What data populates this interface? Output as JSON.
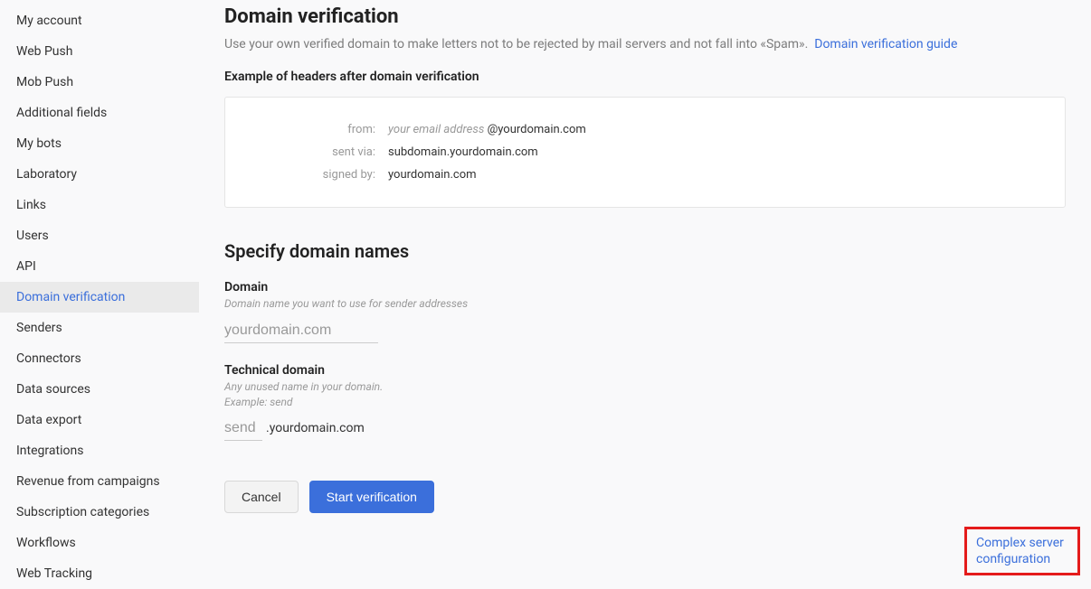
{
  "sidebar": {
    "items": [
      {
        "label": "My account"
      },
      {
        "label": "Web Push"
      },
      {
        "label": "Mob Push"
      },
      {
        "label": "Additional fields"
      },
      {
        "label": "My bots"
      },
      {
        "label": "Laboratory"
      },
      {
        "label": "Links"
      },
      {
        "label": "Users"
      },
      {
        "label": "API"
      },
      {
        "label": "Domain verification",
        "active": true
      },
      {
        "label": "Senders"
      },
      {
        "label": "Connectors"
      },
      {
        "label": "Data sources"
      },
      {
        "label": "Data export"
      },
      {
        "label": "Integrations"
      },
      {
        "label": "Revenue from campaigns"
      },
      {
        "label": "Subscription categories"
      },
      {
        "label": "Workflows"
      },
      {
        "label": "Web Tracking"
      }
    ]
  },
  "page": {
    "title": "Domain verification",
    "description": "Use your own verified domain to make letters not to be rejected by mail servers and not fall into «Spam».",
    "guide_link": "Domain verification guide",
    "example_heading": "Example of headers after domain verification",
    "headers": {
      "from_label": "from:",
      "from_italic": "your email address",
      "from_suffix": " @yourdomain.com",
      "sentvia_label": "sent via:",
      "sentvia_value": "subdomain.yourdomain.com",
      "signedby_label": "signed by:",
      "signedby_value": "yourdomain.com"
    },
    "specify_title": "Specify domain names",
    "domain_label": "Domain",
    "domain_hint": "Domain name you want to use for sender addresses",
    "domain_placeholder": "yourdomain.com",
    "technical_label": "Technical domain",
    "technical_hint": "Any unused name in your domain.\nExample: send",
    "technical_placeholder": "send",
    "technical_suffix": ".yourdomain.com",
    "cancel_btn": "Cancel",
    "start_btn": "Start verification",
    "complex_link": "Complex server configuration"
  }
}
